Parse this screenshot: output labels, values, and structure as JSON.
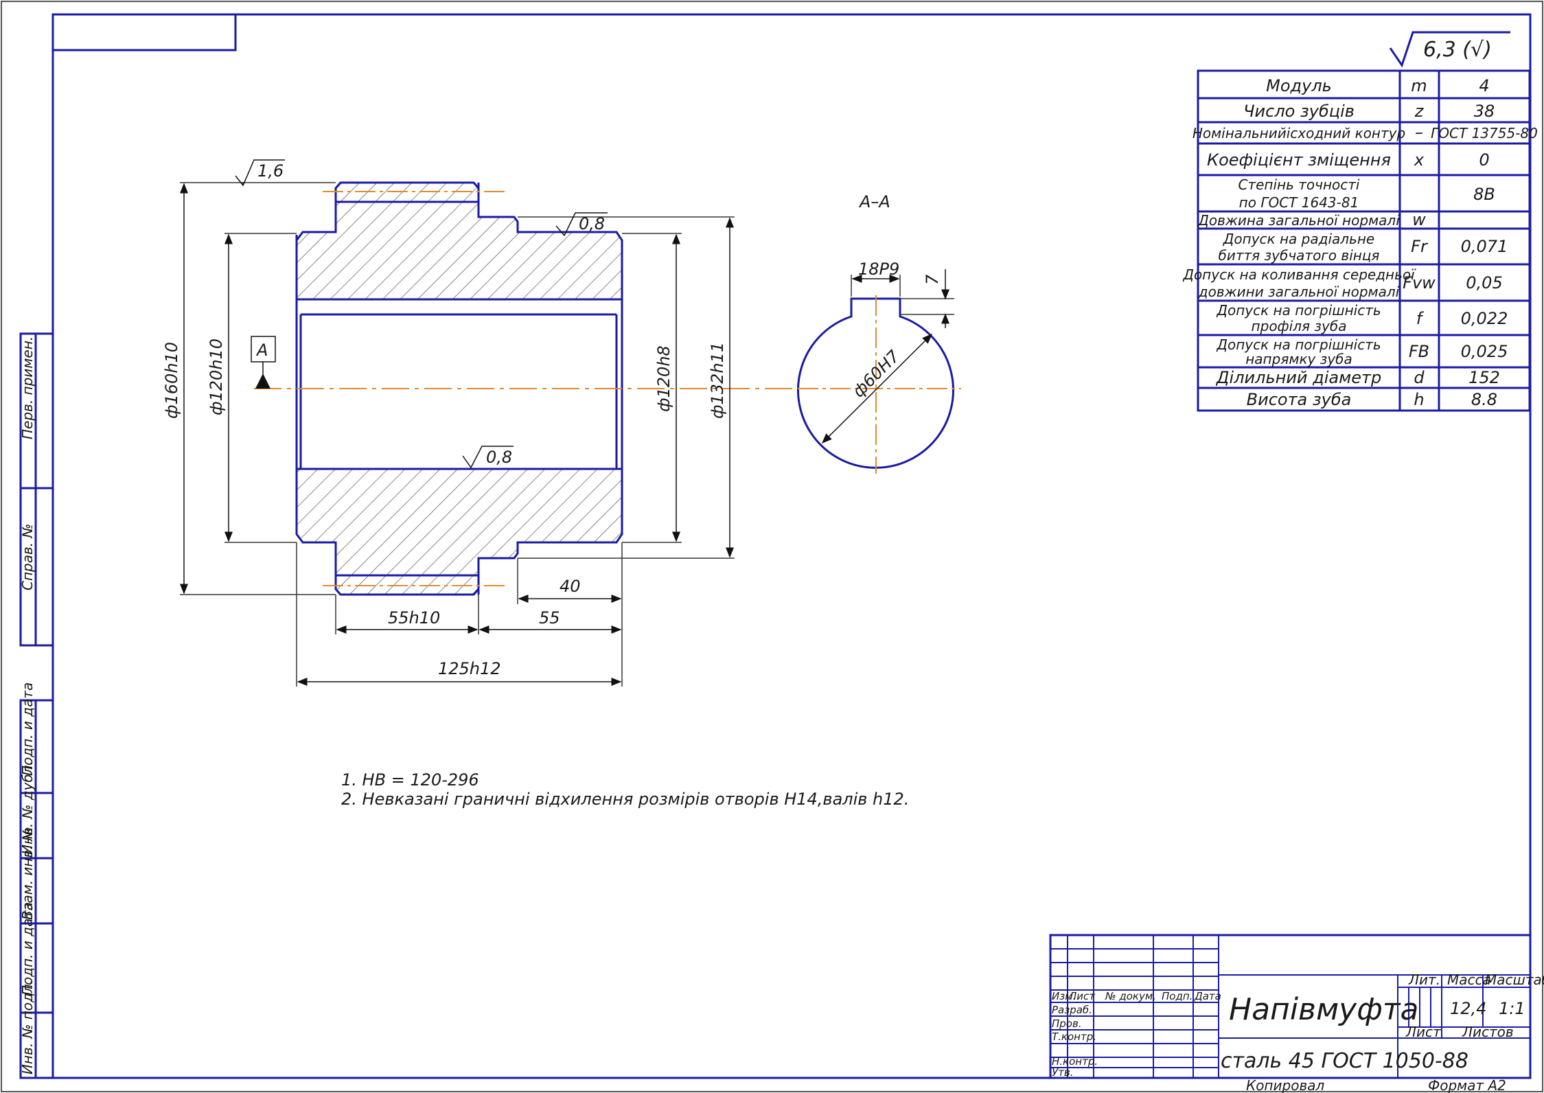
{
  "roughness_general": "6,3 (√)",
  "roughness": {
    "outer": "1,6",
    "key_face": "0,8",
    "bore": "0,8"
  },
  "section_label": "А–А",
  "datum_label": "А",
  "dimensions": {
    "d_outer": "ф160h10",
    "d_hub_left": "ф120h10",
    "d_hub_right": "ф120h8",
    "d_shoulder": "ф132h11",
    "len_55h10": "55h10",
    "len_55": "55",
    "len_40": "40",
    "len_total": "125h12",
    "key_width": "18P9",
    "key_depth": "7",
    "bore": "ф60H7"
  },
  "param_table": [
    {
      "name": "Модуль",
      "sym": "m",
      "val": "4"
    },
    {
      "name": "Число зубців",
      "sym": "z",
      "val": "38"
    },
    {
      "name": "Номінальнийісходний контур",
      "sym": "–",
      "val": "ГОСТ 13755-80"
    },
    {
      "name": "Коефіцієнт зміщення",
      "sym": "x",
      "val": "0"
    },
    {
      "name": "Степінь точності",
      "name2": "по ГОСТ 1643-81",
      "sym": "",
      "val": "8В"
    },
    {
      "name": "Довжина загальної нормалі",
      "sym": "w",
      "val": ""
    },
    {
      "name": "Допуск на радіальне",
      "name2": "биття зубчатого вінця",
      "sym": "Fr",
      "val": "0,071"
    },
    {
      "name": "Допуск на коливання середньої",
      "name2": "довжини загальної нормалі",
      "sym": "Fvw",
      "val": "0,05"
    },
    {
      "name": "Допуск на погрішність",
      "name2": "профіля зуба",
      "sym": "f",
      "val": "0,022"
    },
    {
      "name": "Допуск на погрішність",
      "name2": "напрямку зуба",
      "sym": "FB",
      "val": "0,025"
    },
    {
      "name": "Ділильний діаметр",
      "sym": "d",
      "val": "152"
    },
    {
      "name": "Висота зуба",
      "sym": "h",
      "val": "8.8"
    }
  ],
  "notes": [
    "1. HB = 120-296",
    "2. Невказані граничні відхилення розмірів отворів H14,валів h12."
  ],
  "side_stamp": [
    "Перв. примен.",
    "Справ. №",
    "Подп. и дата",
    "Инв. № дубл.",
    "Взам. инв. №",
    "Подп. и дата",
    "Инв. № подл."
  ],
  "title_block": {
    "title": "Напівмуфта",
    "material": "сталь 45 ГОСТ 1050-88",
    "cols": [
      "Изм.",
      "Лист",
      "№ докум.",
      "Подп.",
      "Дата"
    ],
    "rows": [
      "Разраб.",
      "Пров.",
      "Т.контр.",
      "Н.контр.",
      "Утв."
    ],
    "lit": "Лит.",
    "mass_label": "Масса",
    "scale_label": "Масштаб",
    "mass": "12,4",
    "scale": "1:1",
    "sheet": "Лист",
    "sheets": "Листов",
    "copied": "Копировал",
    "format": "Формат А2"
  },
  "colors": {
    "frame": "#1a1aa6",
    "axis": "#e08a2e",
    "text": "#1a1a1a"
  }
}
